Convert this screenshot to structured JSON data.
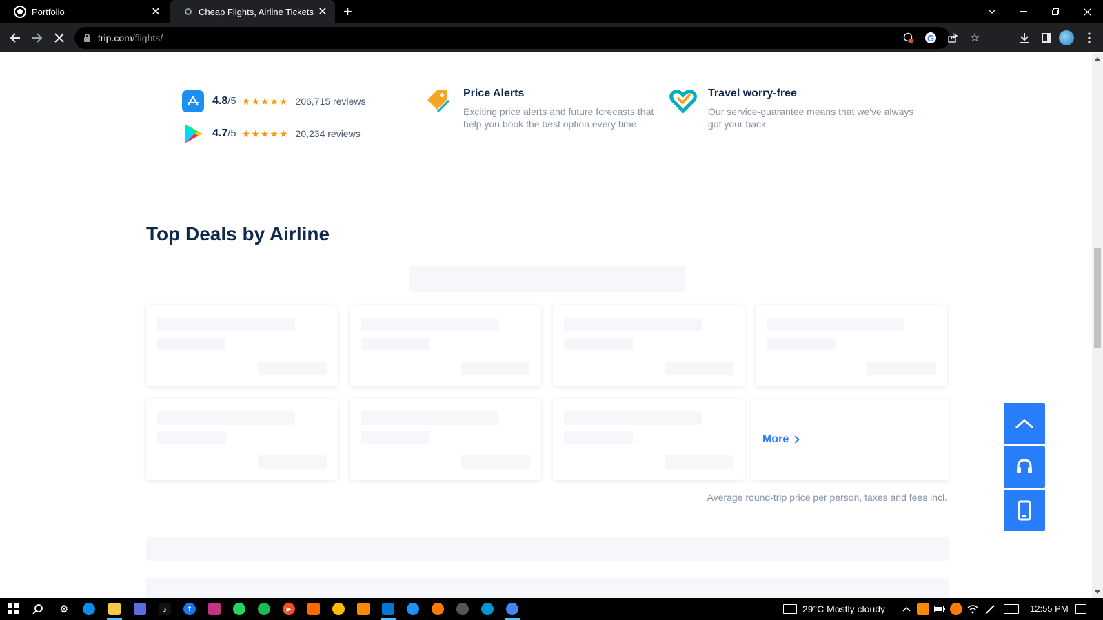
{
  "browser": {
    "tabs": [
      {
        "title": "Portfolio",
        "close": "✕"
      },
      {
        "title": "Cheap Flights, Airline Tickets & P",
        "close": "✕"
      }
    ],
    "new_tab": "+",
    "url_host": "trip.com",
    "url_path": "/flights/"
  },
  "ratings": [
    {
      "score": "4.8",
      "out_of": "/5",
      "stars": "★★★★★",
      "reviews": "206,715 reviews",
      "store": "app-store"
    },
    {
      "score": "4.7",
      "out_of": "/5",
      "stars": "★★★★★",
      "reviews": "20,234 reviews",
      "store": "google-play"
    }
  ],
  "features": [
    {
      "title": "Price Alerts",
      "desc": "Exciting price alerts and future forecasts that help you book the best option every time",
      "icon": "price-tag-icon",
      "color": "#f5a623"
    },
    {
      "title": "Travel worry-free",
      "desc": "Our service-guarantee means that we've always got your back",
      "icon": "heart-check-icon",
      "color": "#06aebd"
    }
  ],
  "deals": {
    "title": "Top Deals by Airline",
    "more_label": "More",
    "note": "Average round-trip price per person, taxes and fees incl."
  },
  "taskbar": {
    "weather": "29°C  Mostly cloudy",
    "time": "12:55 PM"
  },
  "colors": {
    "accent": "#287dfa",
    "heading": "#0f294d",
    "star": "#ff9500"
  }
}
